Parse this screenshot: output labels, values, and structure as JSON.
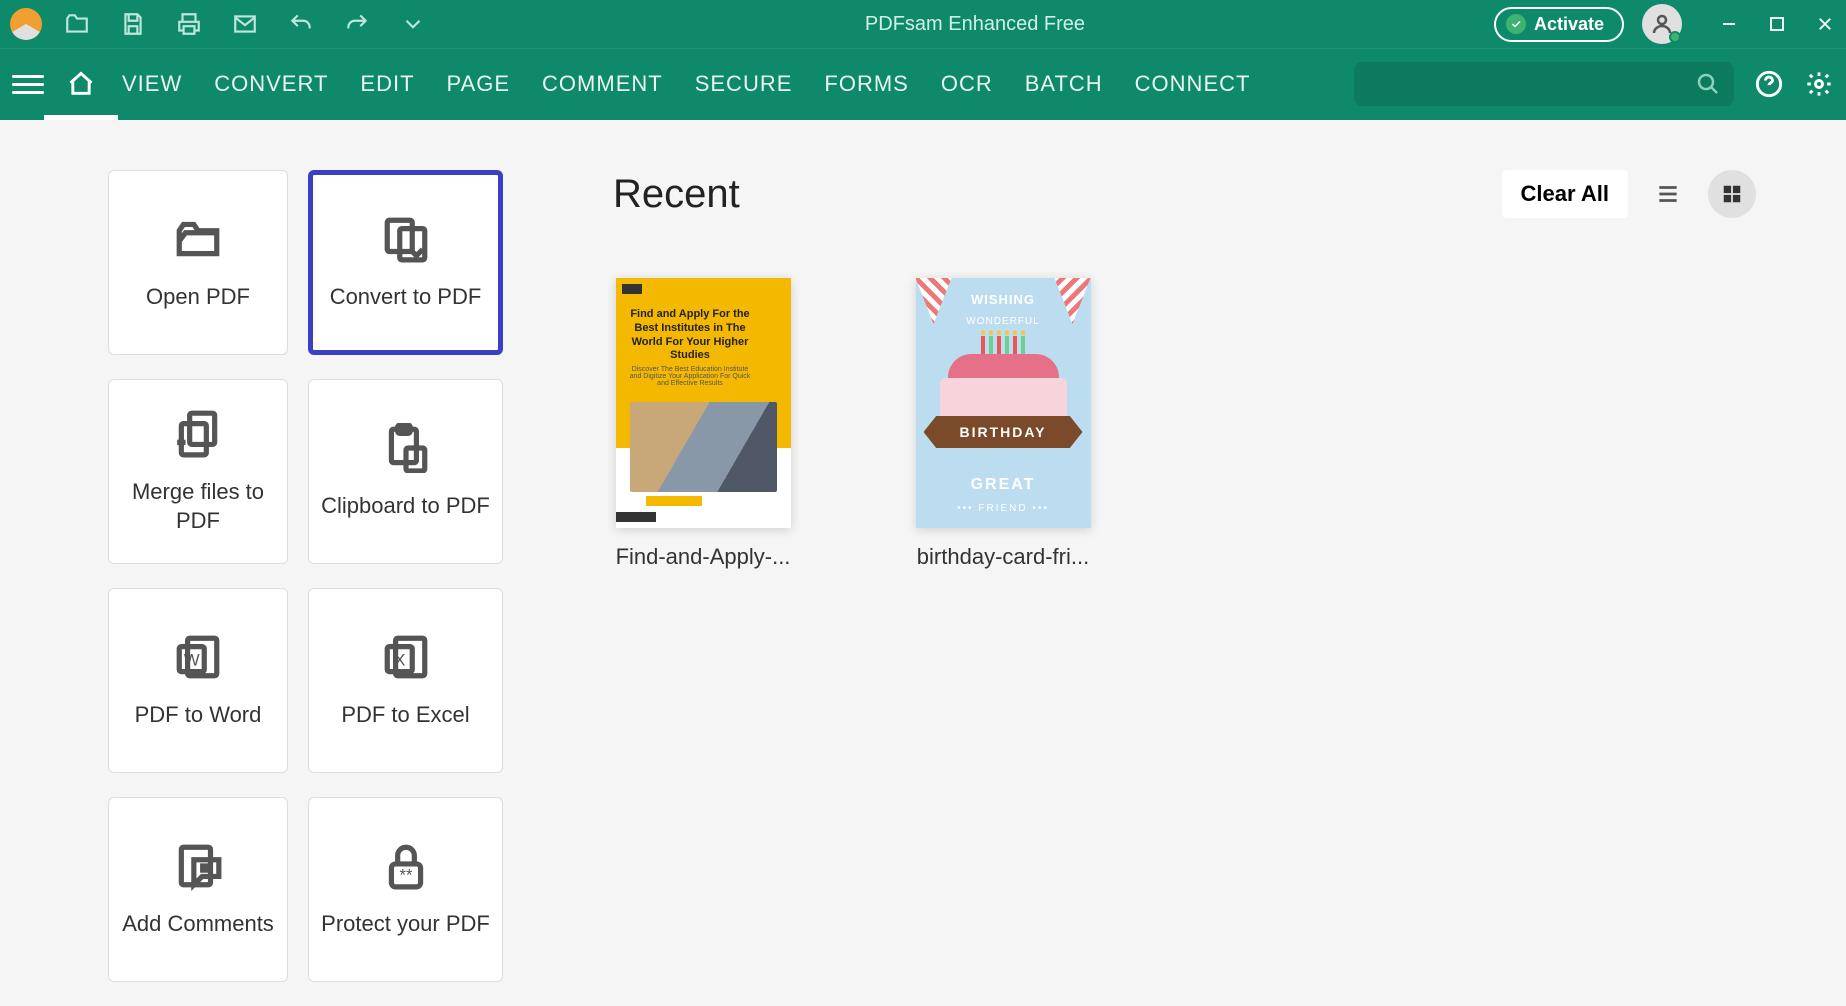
{
  "app_title": "PDFsam Enhanced Free",
  "titlebar": {
    "activate_label": "Activate"
  },
  "menu": {
    "items": [
      "VIEW",
      "CONVERT",
      "EDIT",
      "PAGE",
      "COMMENT",
      "SECURE",
      "FORMS",
      "OCR",
      "BATCH",
      "CONNECT"
    ]
  },
  "search": {
    "placeholder": ""
  },
  "actions": [
    {
      "label": "Open PDF",
      "icon": "folder-open-icon",
      "selected": false
    },
    {
      "label": "Convert to PDF",
      "icon": "convert-icon",
      "selected": true
    },
    {
      "label": "Merge files to PDF",
      "icon": "merge-icon",
      "selected": false
    },
    {
      "label": "Clipboard to PDF",
      "icon": "clipboard-icon",
      "selected": false
    },
    {
      "label": "PDF to Word",
      "icon": "pdf-word-icon",
      "selected": false
    },
    {
      "label": "PDF to Excel",
      "icon": "pdf-excel-icon",
      "selected": false
    },
    {
      "label": "Add Comments",
      "icon": "comment-icon",
      "selected": false
    },
    {
      "label": "Protect your PDF",
      "icon": "lock-icon",
      "selected": false
    }
  ],
  "recent": {
    "title": "Recent",
    "clear_label": "Clear All",
    "files": [
      {
        "name": "Find-and-Apply-..."
      },
      {
        "name": "birthday-card-fri..."
      }
    ]
  },
  "thumb1_text": {
    "headline": "Find and Apply For the Best Institutes in The World For Your Higher Studies",
    "sub": "Discover The Best Education Institute and Digitize Your Application For Quick and Effective Results"
  },
  "thumb2_text": {
    "wish": "WISHING",
    "wonder": "WONDERFUL",
    "ribbon": "BIRTHDAY",
    "great": "GREAT",
    "friend": "••• FRIEND •••"
  }
}
